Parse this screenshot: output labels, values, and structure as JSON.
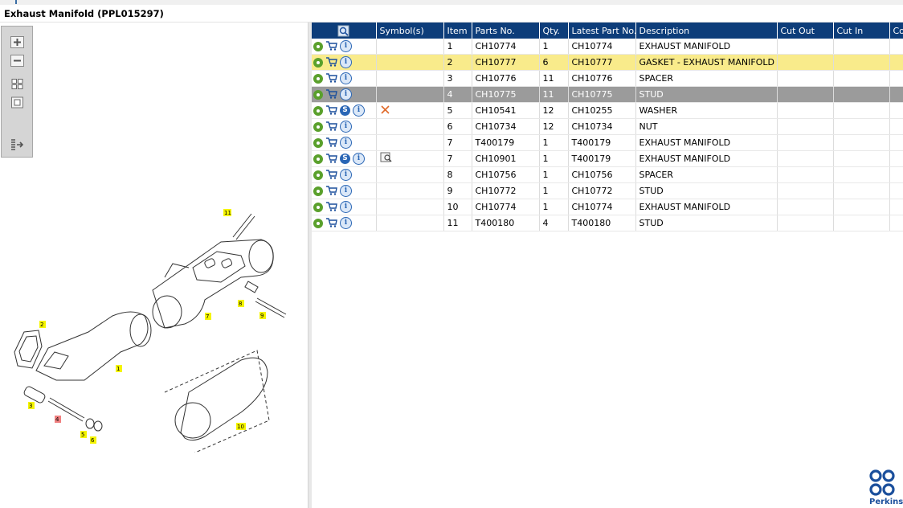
{
  "window": {
    "title": "Exhaust Manifold (PPL015297)"
  },
  "toolbar": {
    "zoom_in": "zoom-in-icon",
    "zoom_out": "zoom-out-icon",
    "fit_all": "fit-all-icon",
    "fit_window": "fit-window-icon",
    "show_list": "show-list-icon"
  },
  "columns": [
    "",
    "Symbol(s)",
    "Item",
    "Parts No.",
    "Qty.",
    "Latest Part No.",
    "Description",
    "Cut Out",
    "Cut In",
    "Co"
  ],
  "rows": [
    {
      "item": "1",
      "part": "CH10774",
      "qty": "1",
      "latest": "CH10774",
      "desc": "EXHAUST MANIFOLD",
      "s_badge": false,
      "symbol": "",
      "state": ""
    },
    {
      "item": "2",
      "part": "CH10777",
      "qty": "6",
      "latest": "CH10777",
      "desc": "GASKET - EXHAUST MANIFOLD",
      "s_badge": false,
      "symbol": "",
      "state": "yellow"
    },
    {
      "item": "3",
      "part": "CH10776",
      "qty": "11",
      "latest": "CH10776",
      "desc": "SPACER",
      "s_badge": false,
      "symbol": "",
      "state": ""
    },
    {
      "item": "4",
      "part": "CH10775",
      "qty": "11",
      "latest": "CH10775",
      "desc": "STUD",
      "s_badge": false,
      "symbol": "",
      "state": "gray"
    },
    {
      "item": "5",
      "part": "CH10541",
      "qty": "12",
      "latest": "CH10255",
      "desc": "WASHER",
      "s_badge": true,
      "symbol": "cross",
      "state": ""
    },
    {
      "item": "6",
      "part": "CH10734",
      "qty": "12",
      "latest": "CH10734",
      "desc": "NUT",
      "s_badge": false,
      "symbol": "",
      "state": ""
    },
    {
      "item": "7",
      "part": "T400179",
      "qty": "1",
      "latest": "T400179",
      "desc": "EXHAUST MANIFOLD",
      "s_badge": false,
      "symbol": "",
      "state": ""
    },
    {
      "item": "7",
      "part": "CH10901",
      "qty": "1",
      "latest": "T400179",
      "desc": "EXHAUST MANIFOLD",
      "s_badge": true,
      "symbol": "book",
      "state": ""
    },
    {
      "item": "8",
      "part": "CH10756",
      "qty": "1",
      "latest": "CH10756",
      "desc": "SPACER",
      "s_badge": false,
      "symbol": "",
      "state": ""
    },
    {
      "item": "9",
      "part": "CH10772",
      "qty": "1",
      "latest": "CH10772",
      "desc": "STUD",
      "s_badge": false,
      "symbol": "",
      "state": ""
    },
    {
      "item": "10",
      "part": "CH10774",
      "qty": "1",
      "latest": "CH10774",
      "desc": "EXHAUST MANIFOLD",
      "s_badge": false,
      "symbol": "",
      "state": ""
    },
    {
      "item": "11",
      "part": "T400180",
      "qty": "4",
      "latest": "T400180",
      "desc": "STUD",
      "s_badge": false,
      "symbol": "",
      "state": ""
    }
  ],
  "callouts": [
    "11",
    "8",
    "9",
    "7",
    "2",
    "1",
    "3",
    "4",
    "5",
    "6",
    "10"
  ],
  "brand": {
    "name": "Perkins",
    "color": "#1b4f9c"
  },
  "colors": {
    "header": "#0d3d7a",
    "row_highlight": "#f9eb8b",
    "row_selected": "#9b9b9b",
    "callout_fill": "#f5f500",
    "callout_selected": "#f08080"
  }
}
